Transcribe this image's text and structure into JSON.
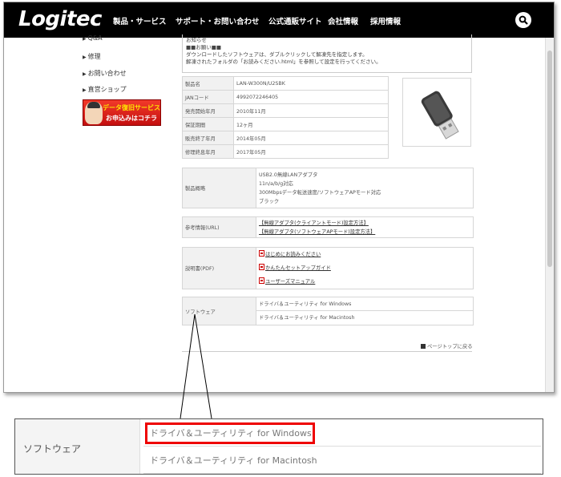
{
  "header": {
    "logo": "Logitec",
    "nav": [
      "製品・サービス",
      "サポート・お問い合わせ",
      "公式通販サイト",
      "会社情報",
      "採用情報"
    ]
  },
  "sidebar": {
    "items": [
      "Q&A",
      "修理",
      "お問い合わせ",
      "直営ショップ"
    ],
    "banner_line1": "データ復旧サービスの",
    "banner_line2": "お申込みはコチラ"
  },
  "notice": {
    "lines": [
      "お知らせ",
      "■■お願い■■",
      "ダウンロードしたソフトウェアは、ダブルクリックして解凍先を指定します。",
      "解凍されたフォルダの「お読みください.html」を参照して設定を行ってください。"
    ]
  },
  "spec": [
    {
      "label": "製品名",
      "value": "LAN-W300N/U2SBK"
    },
    {
      "label": "JANコード",
      "value": "4992072246405"
    },
    {
      "label": "発売開始年月",
      "value": "2010年11月"
    },
    {
      "label": "保証期間",
      "value": "12ヶ月"
    },
    {
      "label": "販売終了年月",
      "value": "2014年05月"
    },
    {
      "label": "修理終息年月",
      "value": "2017年05月"
    }
  ],
  "description": {
    "label": "製品概略",
    "lines": [
      "USB2.0無線LANアダプタ",
      "11n/a/b/g対応",
      "300Mbpsデータ転送速度/ソフトウェアAPモード対応",
      "ブラック"
    ]
  },
  "reference": {
    "label": "参考情報(URL)",
    "links": [
      "【無線アダプタ(クライアントモード)設定方法】",
      "【無線アダプタ(ソフトウェアAPモード)設定方法】"
    ]
  },
  "manuals": {
    "label": "説明書(PDF)",
    "items": [
      "はじめにお読みください",
      "かんたんセットアップガイド",
      "ユーザーズマニュアル"
    ]
  },
  "software": {
    "label": "ソフトウェア",
    "items": [
      "ドライバ＆ユーティリティ for Windows",
      "ドライバ＆ユーティリティ for Macintosh"
    ]
  },
  "page_top": "ページトップに戻る",
  "colors": {
    "header_bg": "#000000",
    "highlight": "#e00000"
  }
}
